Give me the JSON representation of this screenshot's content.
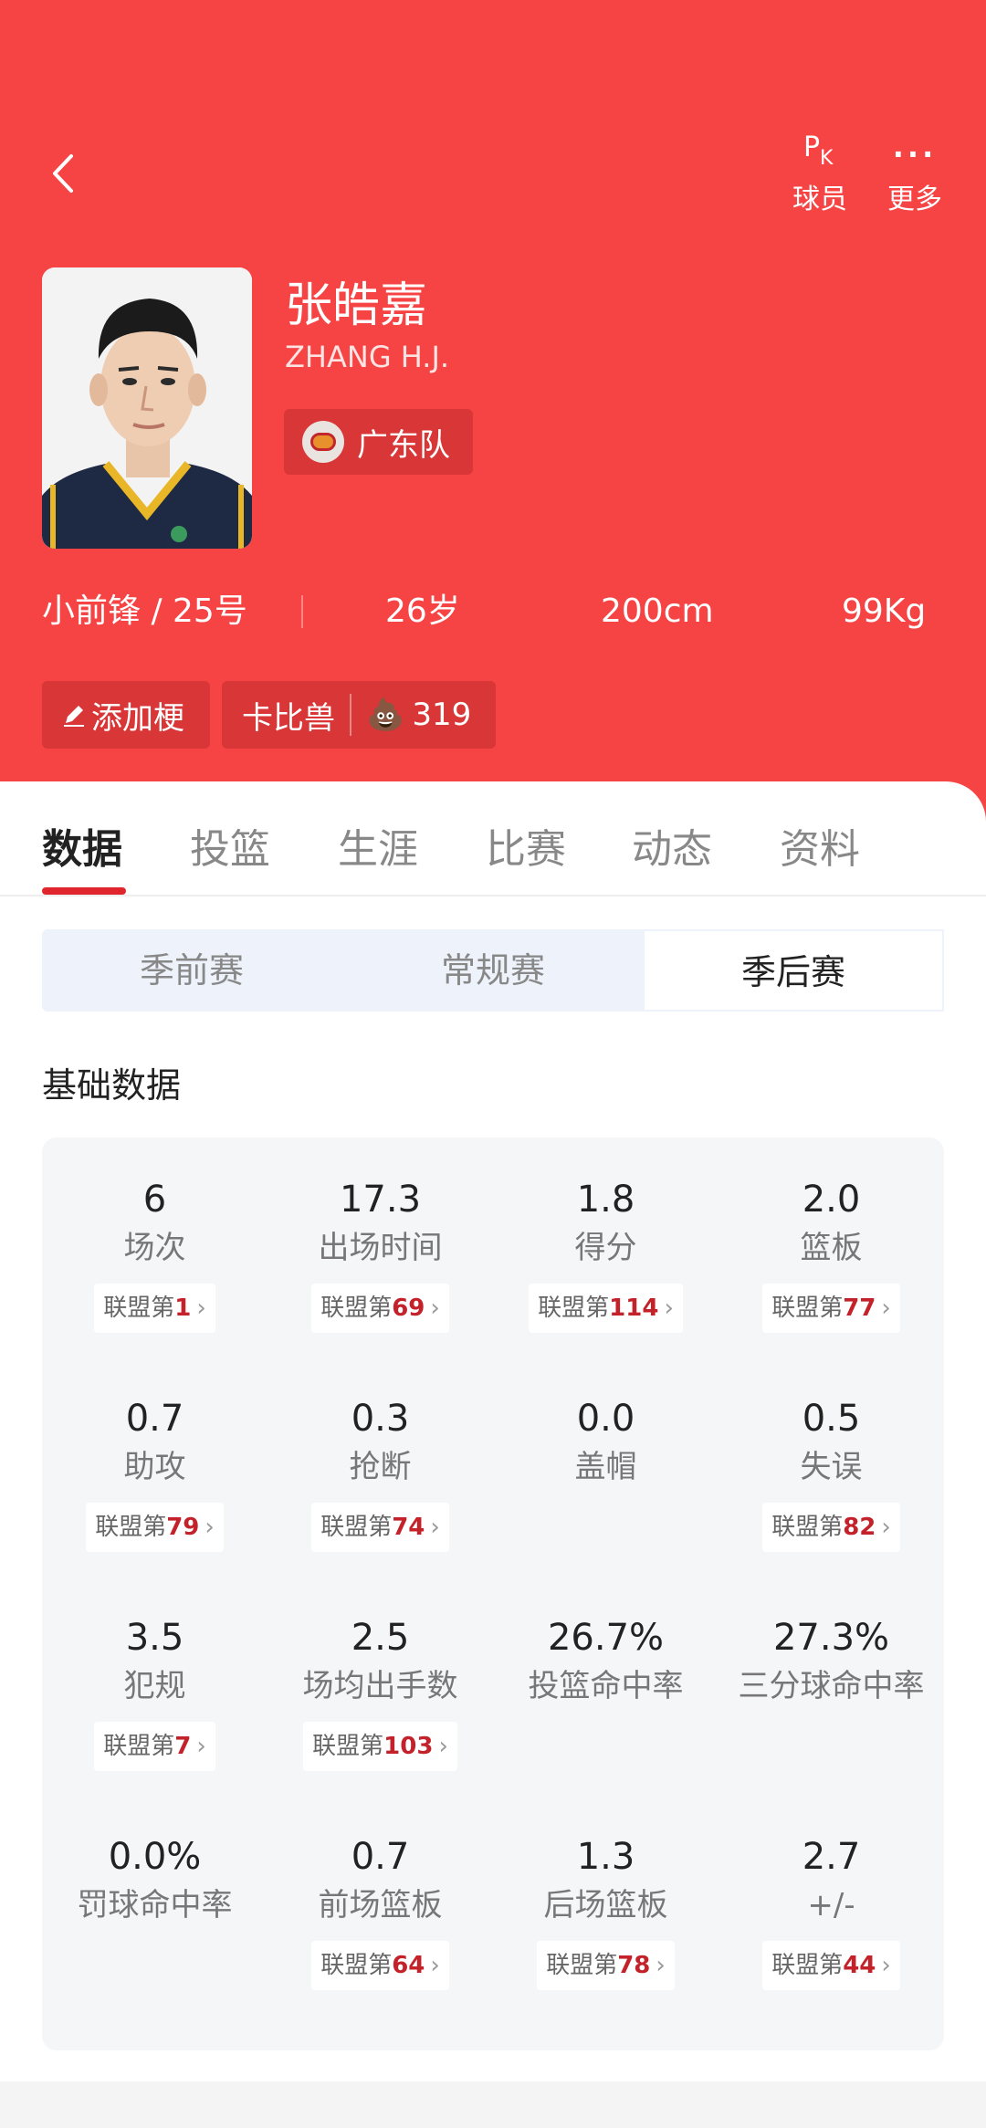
{
  "topbar": {
    "pk_label": "球员",
    "more_label": "更多",
    "pk_icon_p": "P",
    "pk_icon_k": "K",
    "more_icon": "···"
  },
  "player": {
    "name_cn": "张皓嘉",
    "name_en": "ZHANG H.J.",
    "team": "广东队",
    "position_number": "小前锋 / 25号",
    "age": "26岁",
    "height": "200cm",
    "weight": "99Kg"
  },
  "chips": {
    "add_meme": "添加梗",
    "nickname": "卡比兽",
    "nickname_icon": "💩",
    "nickname_count": "319"
  },
  "tabs": [
    "数据",
    "投篮",
    "生涯",
    "比赛",
    "动态",
    "资料"
  ],
  "active_tab": 0,
  "season_types": [
    "季前赛",
    "常规赛",
    "季后赛"
  ],
  "active_season": 2,
  "section_title": "基础数据",
  "rank_prefix": "联盟第",
  "stats": [
    {
      "value": "6",
      "label": "场次",
      "rank": "1"
    },
    {
      "value": "17.3",
      "label": "出场时间",
      "rank": "69"
    },
    {
      "value": "1.8",
      "label": "得分",
      "rank": "114"
    },
    {
      "value": "2.0",
      "label": "篮板",
      "rank": "77"
    },
    {
      "value": "0.7",
      "label": "助攻",
      "rank": "79"
    },
    {
      "value": "0.3",
      "label": "抢断",
      "rank": "74"
    },
    {
      "value": "0.0",
      "label": "盖帽",
      "rank": null
    },
    {
      "value": "0.5",
      "label": "失误",
      "rank": "82"
    },
    {
      "value": "3.5",
      "label": "犯规",
      "rank": "7"
    },
    {
      "value": "2.5",
      "label": "场均出手数",
      "rank": "103"
    },
    {
      "value": "26.7%",
      "label": "投篮命中率",
      "rank": null
    },
    {
      "value": "27.3%",
      "label": "三分球命中率",
      "rank": null
    },
    {
      "value": "0.0%",
      "label": "罚球命中率",
      "rank": null
    },
    {
      "value": "0.7",
      "label": "前场篮板",
      "rank": "64"
    },
    {
      "value": "1.3",
      "label": "后场篮板",
      "rank": "78"
    },
    {
      "value": "2.7",
      "label": "+/-",
      "rank": "44"
    }
  ],
  "colors": {
    "header_red": "#f64445",
    "accent": "#e0262c",
    "rank_red": "#c4222a"
  }
}
